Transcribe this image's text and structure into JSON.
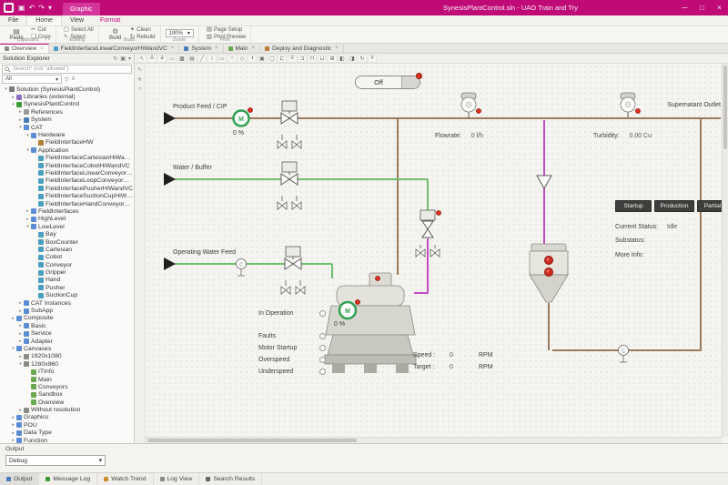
{
  "window": {
    "title": "SynesisPlantControl.sln - UAO Train and Try",
    "contextual_group": "Graphic",
    "controls": {
      "minimize": "─",
      "maximize": "□",
      "close": "×"
    }
  },
  "quick_access": [
    "save",
    "undo",
    "redo",
    "customize"
  ],
  "menu": {
    "tabs": [
      "File",
      "Home",
      "View"
    ],
    "active_tab": "Home",
    "contextual_tab": "Format"
  },
  "ribbon": {
    "clipboard": {
      "label": "Clipboard",
      "paste": "Paste",
      "cut": "Cut",
      "copy": "Copy"
    },
    "editing": {
      "label": "Editing",
      "select_all": "Select All",
      "select": "Select"
    },
    "build": {
      "label": "Build",
      "build": "Build",
      "clean": "Clean",
      "rebuild": "Rebuild"
    },
    "zoom": {
      "label": "Zoom",
      "value": "100%"
    },
    "print": {
      "label": "Print",
      "page_setup": "Page Setup",
      "print_preview": "Print Preview"
    }
  },
  "doc_tabs": [
    {
      "label": "Overview",
      "icon": "canvas",
      "active": true,
      "closable": true
    },
    {
      "label": "FieldInterfaceLinearConveyorHiWandVC",
      "icon": "cat",
      "active": false,
      "closable": true
    },
    {
      "label": "System",
      "icon": "system",
      "active": false,
      "closable": true
    },
    {
      "label": "Main",
      "icon": "page",
      "active": false,
      "closable": true
    },
    {
      "label": "Deploy and Diagnostic",
      "icon": "deploy",
      "active": false,
      "closable": true
    }
  ],
  "solution_explorer": {
    "title": "Solution Explorer",
    "search_placeholder": "Search* (not \"allowed\")",
    "filter": "All",
    "tree": [
      {
        "label": "Solution (SynesisPlantControl)",
        "level": 0,
        "icon": "solution",
        "expander": "open"
      },
      {
        "label": "Libraries (external)",
        "level": 1,
        "icon": "libraries",
        "expander": "closed"
      },
      {
        "label": "SynesisPlantControl",
        "level": 1,
        "icon": "project",
        "expander": "open"
      },
      {
        "label": "References",
        "level": 2,
        "icon": "references",
        "expander": "closed"
      },
      {
        "label": "System",
        "level": 2,
        "icon": "system",
        "expander": "closed"
      },
      {
        "label": "CAT",
        "level": 2,
        "icon": "folder",
        "expander": "open"
      },
      {
        "label": "Hardware",
        "level": 3,
        "icon": "folder",
        "expander": "open"
      },
      {
        "label": "FieldInterfaceHW",
        "level": 4,
        "icon": "device",
        "expander": null
      },
      {
        "label": "Application",
        "level": 3,
        "icon": "folder",
        "expander": "open"
      },
      {
        "label": "FieldInterfaceCartesianHiWandVC",
        "level": 4,
        "icon": "cat",
        "expander": null
      },
      {
        "label": "FieldInterfaceCobotHiWandVC",
        "level": 4,
        "icon": "cat",
        "expander": null
      },
      {
        "label": "FieldInterfaceLinearConveyorHiWandVC",
        "level": 4,
        "icon": "cat",
        "expander": null
      },
      {
        "label": "FieldInterfaceLoopConveyorHiWandVC",
        "level": 4,
        "icon": "cat",
        "expander": null
      },
      {
        "label": "FieldInterfacePusherHiWandVC",
        "level": 4,
        "icon": "cat",
        "expander": null
      },
      {
        "label": "FieldInterfaceSuctionCupHiWandVC",
        "level": 4,
        "icon": "cat",
        "expander": null
      },
      {
        "label": "FieldInterfaceHandConveyorHiWandVC",
        "level": 4,
        "icon": "cat",
        "expander": null
      },
      {
        "label": "FieldInterfaces",
        "level": 3,
        "icon": "folder",
        "expander": "closed"
      },
      {
        "label": "HighLevel",
        "level": 3,
        "icon": "folder",
        "expander": "closed"
      },
      {
        "label": "LowLevel",
        "level": 3,
        "icon": "folder",
        "expander": "open"
      },
      {
        "label": "Bay",
        "level": 4,
        "icon": "cat",
        "expander": null
      },
      {
        "label": "BoxCounter",
        "level": 4,
        "icon": "cat",
        "expander": null
      },
      {
        "label": "Cartesian",
        "level": 4,
        "icon": "cat",
        "expander": null
      },
      {
        "label": "Cobot",
        "level": 4,
        "icon": "cat",
        "expander": null
      },
      {
        "label": "Conveyor",
        "level": 4,
        "icon": "cat",
        "expander": null
      },
      {
        "label": "Gripper",
        "level": 4,
        "icon": "cat",
        "expander": null
      },
      {
        "label": "Hand",
        "level": 4,
        "icon": "cat",
        "expander": null
      },
      {
        "label": "Pusher",
        "level": 4,
        "icon": "cat",
        "expander": null
      },
      {
        "label": "SuctionCup",
        "level": 4,
        "icon": "cat",
        "expander": null
      },
      {
        "label": "CAT Instances",
        "level": 2,
        "icon": "folder",
        "expander": "closed"
      },
      {
        "label": "SubApp",
        "level": 2,
        "icon": "folder",
        "expander": "closed"
      },
      {
        "label": "Composite",
        "level": 1,
        "icon": "folder",
        "expander": "closed"
      },
      {
        "label": "Basic",
        "level": 2,
        "icon": "folder",
        "expander": "closed"
      },
      {
        "label": "Service",
        "level": 2,
        "icon": "folder",
        "expander": "closed"
      },
      {
        "label": "Adapter",
        "level": 2,
        "icon": "folder",
        "expander": "closed"
      },
      {
        "label": "Canvases",
        "level": 1,
        "icon": "folder",
        "expander": "open"
      },
      {
        "label": "1920x1080",
        "level": 2,
        "icon": "canvas",
        "expander": "closed"
      },
      {
        "label": "1280x960",
        "level": 2,
        "icon": "canvas",
        "expander": "open"
      },
      {
        "label": "ITInfo",
        "level": 3,
        "icon": "page",
        "expander": null
      },
      {
        "label": "Main",
        "level": 3,
        "icon": "page",
        "expander": null
      },
      {
        "label": "Conveyors",
        "level": 3,
        "icon": "page",
        "expander": null
      },
      {
        "label": "Sandbox",
        "level": 3,
        "icon": "page",
        "expander": null
      },
      {
        "label": "Overview",
        "level": 3,
        "icon": "page",
        "expander": null
      },
      {
        "label": "Without resolution",
        "level": 2,
        "icon": "canvas",
        "expander": "closed"
      },
      {
        "label": "Graphics",
        "level": 1,
        "icon": "folder",
        "expander": "closed"
      },
      {
        "label": "POU",
        "level": 1,
        "icon": "folder",
        "expander": "closed"
      },
      {
        "label": "Data Type",
        "level": 1,
        "icon": "folder",
        "expander": "closed"
      },
      {
        "label": "Function",
        "level": 1,
        "icon": "folder",
        "expander": "closed"
      }
    ]
  },
  "canvas_toolbar_icons": [
    "cursor",
    "text",
    "label",
    "button",
    "image",
    "chart",
    "line",
    "polyline",
    "rectangle",
    "ellipse",
    "polygon",
    "pie",
    "group",
    "ungroup",
    "align-left",
    "align-center",
    "align-right",
    "align-top",
    "align-bottom",
    "same-size",
    "bring-front",
    "send-back",
    "rotate",
    "grid"
  ],
  "side_toolbar_icons": [
    "pointer",
    "hand",
    "zoom"
  ],
  "explorer_header_icons": [
    "sync",
    "pin",
    "menu"
  ],
  "canvas": {
    "power_toggle": "Off",
    "feeds": {
      "product": "Product Feed / CIP",
      "water": "Water / Buffer",
      "operating": "Operating Water Feed",
      "outlet": "Supernatant Outlet"
    },
    "instruments": {
      "flowrate_label": "Flowrate:",
      "flowrate_value": "0 l/h",
      "turbidity_label": "Turbidity:",
      "turbidity_value": "0.00 Cu"
    },
    "pump_speed": "0 %",
    "mode_buttons": [
      "Startup",
      "Production",
      "Partial E"
    ],
    "status": {
      "current_label": "Current Status:",
      "current_value": "Idle",
      "substatus_label": "Substatus:",
      "more_info_label": "More Info:"
    },
    "machine": {
      "motor_label": "M",
      "motor_speed": "0 %",
      "indicators": [
        "In Operation",
        "Faults",
        "Motor Startup",
        "Overspeed",
        "Underspeed"
      ],
      "speed": {
        "label": "Speed :",
        "value": "0",
        "unit": "RPM"
      },
      "target": {
        "label": "Target :",
        "value": "0",
        "unit": "RPM"
      }
    }
  },
  "output_panel": {
    "title": "Output",
    "mode": "Debug"
  },
  "status_bar": {
    "active": "Output",
    "tabs": [
      "Output",
      "Message Log",
      "Watch Trend",
      "Log View",
      "Search Results"
    ]
  },
  "colors": {
    "titlebar_magenta": "#c00a78",
    "pipe_brown": "#9b7a5e",
    "pipe_green": "#6fbf6f",
    "pipe_magenta": "#c24ec2",
    "indicator_red": "#e0301e",
    "motor_green": "#2fa052",
    "mode_button_dark": "#3e3e3c"
  }
}
